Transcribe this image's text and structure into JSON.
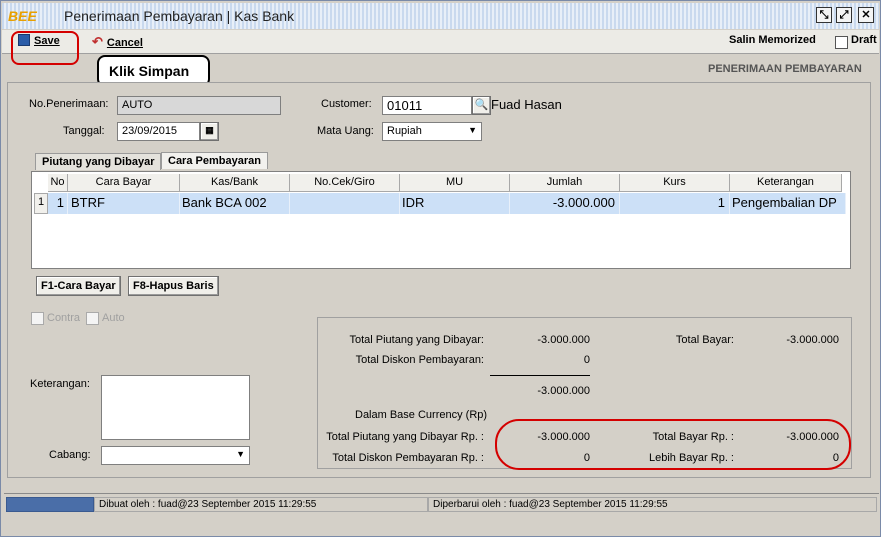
{
  "window": {
    "logo": "BEE",
    "title": "Penerimaan Pembayaran | Kas Bank"
  },
  "toolbar": {
    "save_label": "Save",
    "cancel_label": "Cancel",
    "salin_label": "Salin Memorized",
    "draft_label": "Draft"
  },
  "callout": {
    "text": "Klik Simpan"
  },
  "header": {
    "section_title": "PENERIMAAN PEMBAYARAN"
  },
  "form": {
    "no_label": "No.Penerimaan:",
    "no_value": "AUTO",
    "tanggal_label": "Tanggal:",
    "tanggal_value": "23/09/2015",
    "customer_label": "Customer:",
    "customer_code": "01011",
    "customer_name": "Fuad Hasan",
    "mata_uang_label": "Mata Uang:",
    "mata_uang_value": "Rupiah"
  },
  "tabs": [
    {
      "label": "Piutang yang Dibayar"
    },
    {
      "label": "Cara Pembayaran"
    }
  ],
  "grid": {
    "columns": [
      "No",
      "Cara Bayar",
      "Kas/Bank",
      "No.Cek/Giro",
      "MU",
      "Jumlah",
      "Kurs",
      "Keterangan"
    ],
    "rows": [
      {
        "rownum": "1",
        "no": "1",
        "cara_bayar": "BTRF",
        "kas_bank": "Bank BCA 002",
        "no_cek": "",
        "mu": "IDR",
        "jumlah": "-3.000.000",
        "kurs": "1",
        "keterangan": "Pengembalian DP"
      }
    ]
  },
  "buttons": {
    "f1": "F1-Cara Bayar",
    "f8": "F8-Hapus Baris"
  },
  "options": {
    "contra": "Contra",
    "auto": "Auto"
  },
  "bottom": {
    "keterangan_label": "Keterangan:",
    "cabang_label": "Cabang:",
    "cabang_value": ""
  },
  "totals": {
    "total_piutang_label": "Total Piutang yang Dibayar:",
    "total_piutang_value": "-3.000.000",
    "total_diskon_label": "Total Diskon Pembayaran:",
    "total_diskon_value": "0",
    "subtotal_value": "-3.000.000",
    "total_bayar_label": "Total Bayar:",
    "total_bayar_value": "-3.000.000",
    "base_currency_label": "Dalam Base Currency (Rp)",
    "base_piutang_label": "Total Piutang yang Dibayar Rp. :",
    "base_piutang_value": "-3.000.000",
    "base_diskon_label": "Total Diskon Pembayaran Rp. :",
    "base_diskon_value": "0",
    "base_bayar_label": "Total Bayar Rp. :",
    "base_bayar_value": "-3.000.000",
    "lebih_bayar_label": "Lebih Bayar Rp. :",
    "lebih_bayar_value": "0"
  },
  "status": {
    "dibuat": "Dibuat oleh : fuad@23 September 2015  11:29:55",
    "diperbarui": "Diperbarui oleh : fuad@23 September 2015  11:29:55"
  }
}
